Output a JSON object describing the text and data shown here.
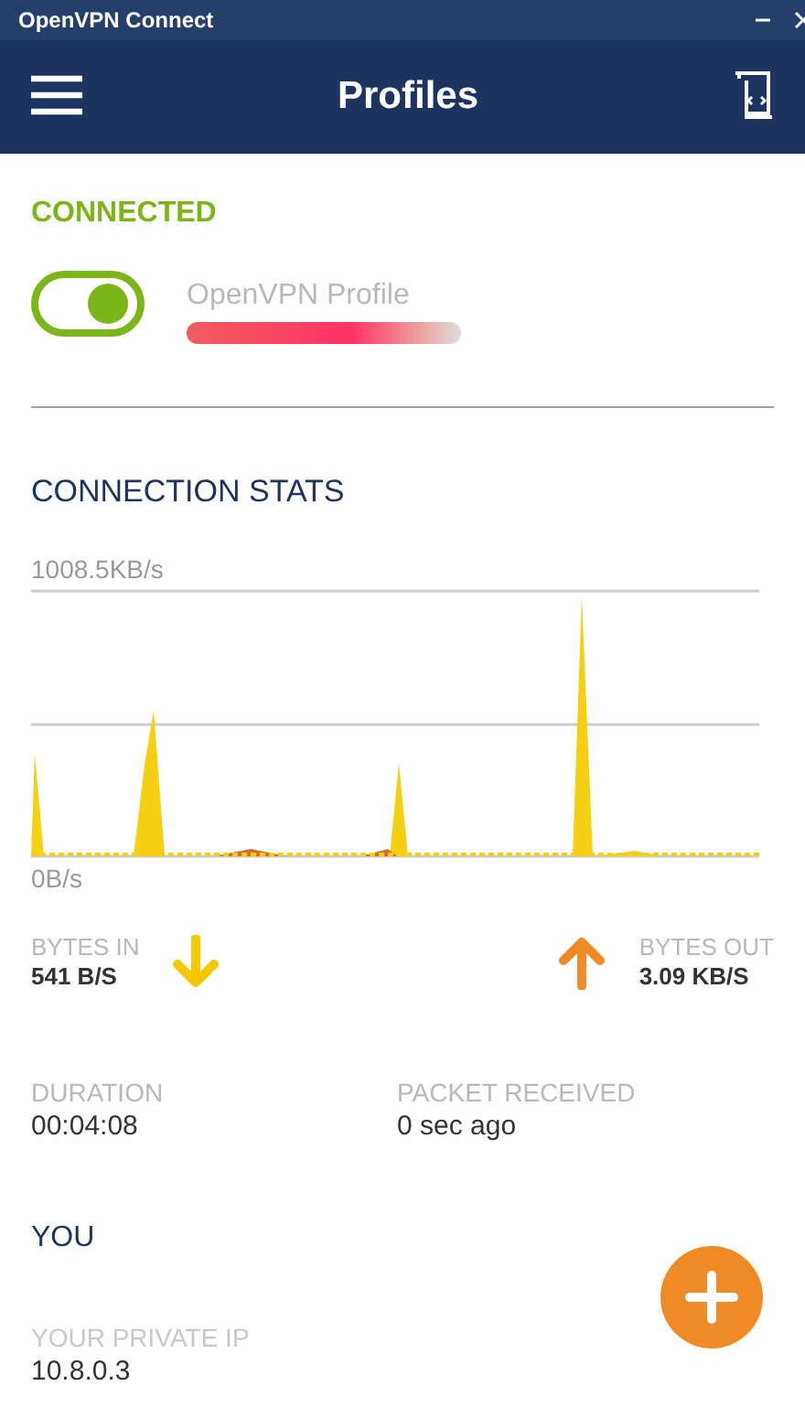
{
  "window": {
    "title": "OpenVPN Connect"
  },
  "header": {
    "title": "Profiles"
  },
  "connection": {
    "status": "CONNECTED",
    "profile_name": "OpenVPN Profile",
    "on": true
  },
  "stats": {
    "heading": "CONNECTION STATS",
    "max_label": "1008.5KB/s",
    "min_label": "0B/s",
    "bytes_in": {
      "label": "BYTES IN",
      "value": "541 B/S"
    },
    "bytes_out": {
      "label": "BYTES OUT",
      "value": "3.09 KB/S"
    }
  },
  "details": [
    {
      "label": "DURATION",
      "value": "00:04:08"
    },
    {
      "label": "PACKET RECEIVED",
      "value": "0 sec ago"
    }
  ],
  "you": {
    "heading": "YOU",
    "private_ip_label": "YOUR PRIVATE IP",
    "private_ip": "10.8.0.3"
  }
}
